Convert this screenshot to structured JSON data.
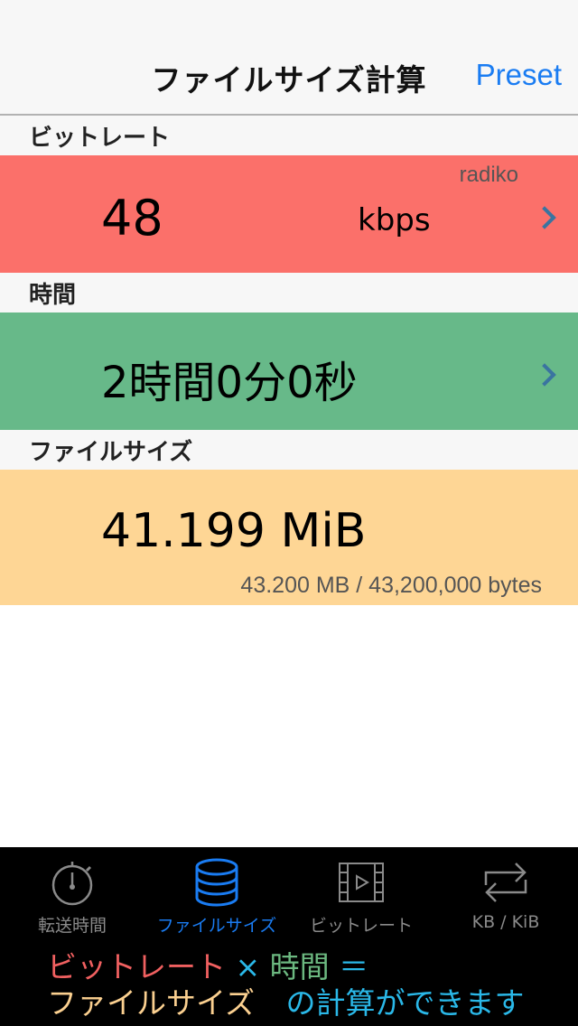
{
  "navbar": {
    "title": "ファイルサイズ計算",
    "preset_label": "Preset"
  },
  "sections": {
    "bitrate": {
      "header": "ビットレート",
      "value": "48",
      "unit": "kbps",
      "preset_name": "radiko",
      "color": "#fb706a"
    },
    "time": {
      "header": "時間",
      "value": "2時間0分0秒",
      "color": "#67b989"
    },
    "filesize": {
      "header": "ファイルサイズ",
      "value": "41.199 MiB",
      "detail": "43.200 MB / 43,200,000 bytes",
      "color": "#fed695"
    }
  },
  "tabbar": {
    "items": [
      {
        "label": "転送時間",
        "icon": "stopwatch-icon",
        "active": false
      },
      {
        "label": "ファイルサイズ",
        "icon": "database-icon",
        "active": true
      },
      {
        "label": "ビットレート",
        "icon": "film-icon",
        "active": false
      },
      {
        "label": "KB / KiB",
        "icon": "repeat-arrows-icon",
        "active": false
      }
    ]
  },
  "promo": {
    "line1_bitrate": "ビットレート",
    "line1_times": "×",
    "line1_time": "時間",
    "line1_equals": "＝",
    "line2_filesize": "ファイルサイズ",
    "line2_rest": "の計算ができます",
    "colors": {
      "bitrate": "#f06060",
      "times": "#2ab8e8",
      "time": "#6cb880",
      "equals": "#2ab8e8",
      "filesize": "#fbd090",
      "rest": "#2ab8e8"
    }
  }
}
